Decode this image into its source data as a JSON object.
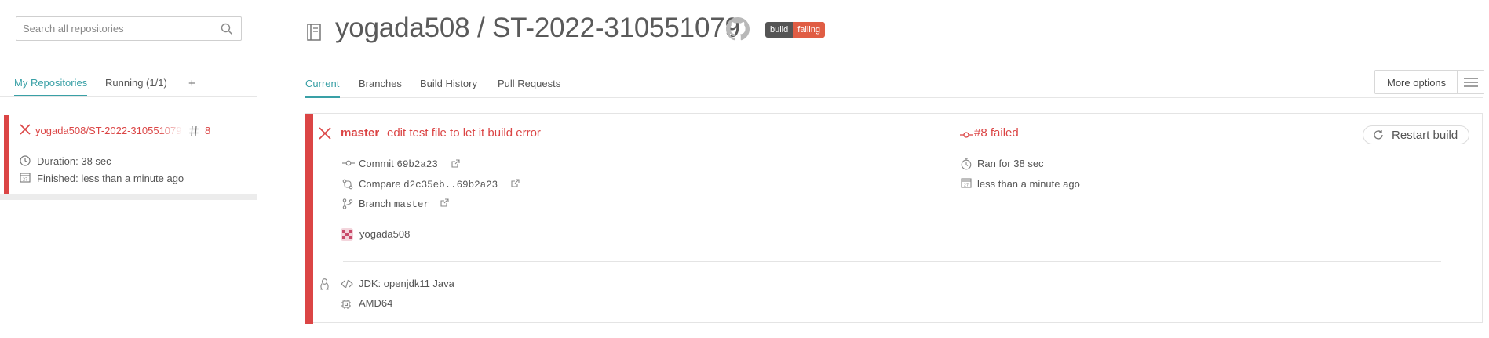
{
  "sidebar": {
    "search_placeholder": "Search all repositories",
    "tabs": [
      {
        "label": "My Repositories",
        "active": true
      },
      {
        "label": "Running (1/1)",
        "active": false
      },
      {
        "label": "+",
        "active": false
      }
    ],
    "repo": {
      "name": "yogada508/ST-2022-310551079",
      "build_number": "8",
      "status": "failed",
      "duration": "Duration: 38 sec",
      "finished": "Finished: less than a minute ago"
    }
  },
  "header": {
    "title": "yogada508 / ST-2022-310551079",
    "badge": {
      "left": "build",
      "right": "failing"
    }
  },
  "tabs": [
    {
      "label": "Current",
      "active": true
    },
    {
      "label": "Branches",
      "active": false
    },
    {
      "label": "Build History",
      "active": false
    },
    {
      "label": "Pull Requests",
      "active": false
    }
  ],
  "more_options_label": "More options",
  "build": {
    "branch": "master",
    "message": "edit test file to let it build error",
    "status_text": "#8 failed",
    "restart_label": "Restart build",
    "commit_label": "Commit",
    "commit_hash": "69b2a23",
    "compare_label": "Compare",
    "compare_range": "d2c35eb..69b2a23",
    "branch_label": "Branch",
    "branch_value": "master",
    "author": "yogada508",
    "ran_for": "Ran for 38 sec",
    "finished": "less than a minute ago",
    "calendar_day": "27",
    "jdk": "JDK: openjdk11 Java",
    "arch": "AMD64"
  },
  "colors": {
    "accent": "#39a0a6",
    "failed": "#db4545",
    "badge_dark": "#555555",
    "badge_fail": "#e05d44"
  },
  "icons": {
    "search": "search-icon",
    "fail": "close-icon",
    "hash": "hash-icon",
    "clock": "clock-icon",
    "calendar": "calendar-icon",
    "repo": "book-icon",
    "github": "github-icon",
    "menu": "menu-icon",
    "restart": "restart-icon",
    "commit": "commit-icon",
    "compare": "compare-icon",
    "branch": "branch-icon",
    "external": "external-link-icon",
    "stopwatch": "stopwatch-icon",
    "linux": "linux-icon",
    "code": "code-icon",
    "chip": "chip-icon"
  }
}
